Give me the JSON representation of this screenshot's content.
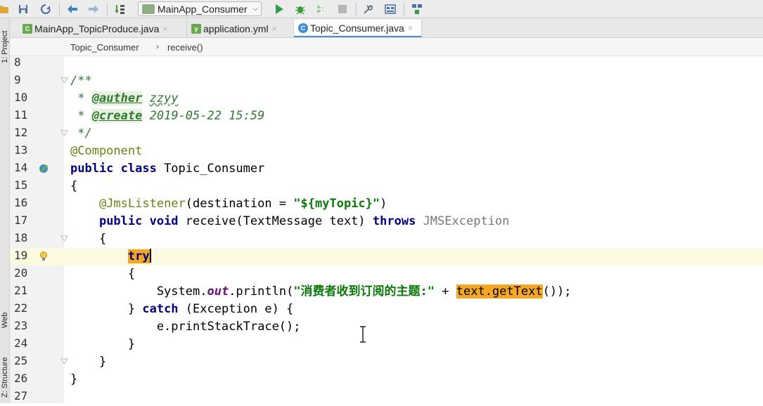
{
  "toolbar": {
    "run_config": "MainApp_Consumer",
    "icons": [
      "open-icon",
      "save-icon",
      "sync-icon",
      "back-icon",
      "forward-icon",
      "build-icon",
      "run-config-icon",
      "run-icon",
      "debug-icon",
      "coverage-icon",
      "stop-icon",
      "project-structure-icon",
      "sdk-icon",
      "structure-icon"
    ]
  },
  "side_tabs": {
    "project": "1: Project",
    "web": "Web",
    "structure": "Z: Structure"
  },
  "tabs": [
    {
      "label": "MainApp_TopicProduce.java",
      "icon": "spring-class-icon",
      "active": false
    },
    {
      "label": "application.yml",
      "icon": "spring-yml-icon",
      "active": false
    },
    {
      "label": "Topic_Consumer.java",
      "icon": "class-icon",
      "active": true
    }
  ],
  "tab_close_glyph": "×",
  "breadcrumb": {
    "class_name": "Topic_Consumer",
    "separator": "›",
    "method_name": "receive()"
  },
  "lines": [
    {
      "n": "8",
      "t": []
    },
    {
      "n": "9",
      "t": [
        [
          "cmt",
          "/**"
        ]
      ]
    },
    {
      "n": "10",
      "t": [
        [
          "cmt",
          " * "
        ],
        [
          "tag",
          "@auther"
        ],
        [
          "cmt",
          " "
        ],
        [
          "cmt squig",
          "zzyy"
        ]
      ]
    },
    {
      "n": "11",
      "t": [
        [
          "cmt",
          " * "
        ],
        [
          "tag",
          "@create"
        ],
        [
          "cmt",
          " 2019-05-22 15:59"
        ]
      ]
    },
    {
      "n": "12",
      "t": [
        [
          "cmt",
          " */"
        ]
      ]
    },
    {
      "n": "13",
      "t": [
        [
          "ann",
          "@Component"
        ]
      ]
    },
    {
      "n": "14",
      "t": [
        [
          "kw",
          "public class"
        ],
        [
          "",
          " Topic_Consumer"
        ]
      ]
    },
    {
      "n": "15",
      "t": [
        [
          "",
          "{"
        ]
      ]
    },
    {
      "n": "16",
      "t": [
        [
          "",
          "    "
        ],
        [
          "ann",
          "@JmsListener"
        ],
        [
          "",
          "(destination = "
        ],
        [
          "str",
          "\"${myTopic}\""
        ],
        [
          "",
          ")"
        ]
      ]
    },
    {
      "n": "17",
      "t": [
        [
          "",
          "    "
        ],
        [
          "kw",
          "public void"
        ],
        [
          "",
          " receive(TextMessage text) "
        ],
        [
          "kw",
          "throws"
        ],
        [
          "",
          " "
        ],
        [
          "dim",
          "JMSException"
        ]
      ]
    },
    {
      "n": "18",
      "t": [
        [
          "",
          "    {"
        ]
      ]
    },
    {
      "n": "19",
      "t": [
        [
          "",
          "        "
        ],
        [
          "kw hl",
          "try"
        ],
        [
          "caret",
          ""
        ]
      ],
      "current": true
    },
    {
      "n": "20",
      "t": [
        [
          "",
          "        {"
        ]
      ]
    },
    {
      "n": "21",
      "t": [
        [
          "",
          "            System."
        ],
        [
          "ital",
          "out"
        ],
        [
          "",
          ".println("
        ],
        [
          "str",
          "\"消费者收到订阅的主题:\""
        ],
        [
          "",
          " + "
        ],
        [
          "hl",
          "text.getText"
        ],
        [
          "",
          "());"
        ]
      ]
    },
    {
      "n": "22",
      "t": [
        [
          "",
          "        } "
        ],
        [
          "kw",
          "catch"
        ],
        [
          "",
          " (Exception e) {"
        ]
      ]
    },
    {
      "n": "23",
      "t": [
        [
          "",
          "            e.printStackTrace();"
        ]
      ]
    },
    {
      "n": "24",
      "t": [
        [
          "",
          "        }"
        ]
      ]
    },
    {
      "n": "25",
      "t": [
        [
          "",
          "    }"
        ]
      ]
    },
    {
      "n": "26",
      "t": [
        [
          "",
          "}"
        ]
      ]
    },
    {
      "n": "27",
      "t": []
    }
  ],
  "gutter_marks": {
    "14": "bean-class-icon",
    "19": "lightbulb-icon"
  },
  "fold_lines": [
    "9",
    "12",
    "18",
    "25"
  ],
  "colors": {
    "keyword": "#000080",
    "string": "#0a7a0a",
    "comment": "#2f7a2f",
    "annotation": "#6f7e12",
    "search_highlight": "#f5a623",
    "current_line": "#fcfae0",
    "active_tab_underline": "#4a90d9"
  }
}
